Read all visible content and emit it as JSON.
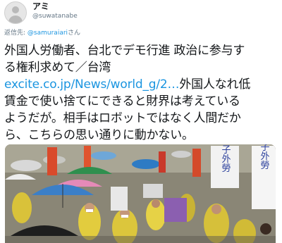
{
  "tweet": {
    "display_name": "アミ",
    "handle": "@suwatanabe",
    "reply_prefix": "返信先:",
    "reply_handle": "@samuraiari",
    "reply_suffix": "さん",
    "text_line1": "外国人労働者、台北でデモ行進 政治に参与す",
    "text_line2": "る権利求めて／台湾",
    "link_text": "excite.co.jp/News/world_g/2…",
    "text_after_link": "外国人なれ低",
    "text_line4": "賃金で使い捨てにできると財界は考えている",
    "text_line5": "ようだが。相手はロボットではなく人間だか",
    "text_line6": "ら、こちらの思い通りに動かない。"
  },
  "photo": {
    "sign_right_1": "子外勞",
    "sign_right_2": "子外勞"
  },
  "colors": {
    "link": "#1b95e0",
    "secondary_text": "#657786",
    "primary_text": "#14171a"
  }
}
